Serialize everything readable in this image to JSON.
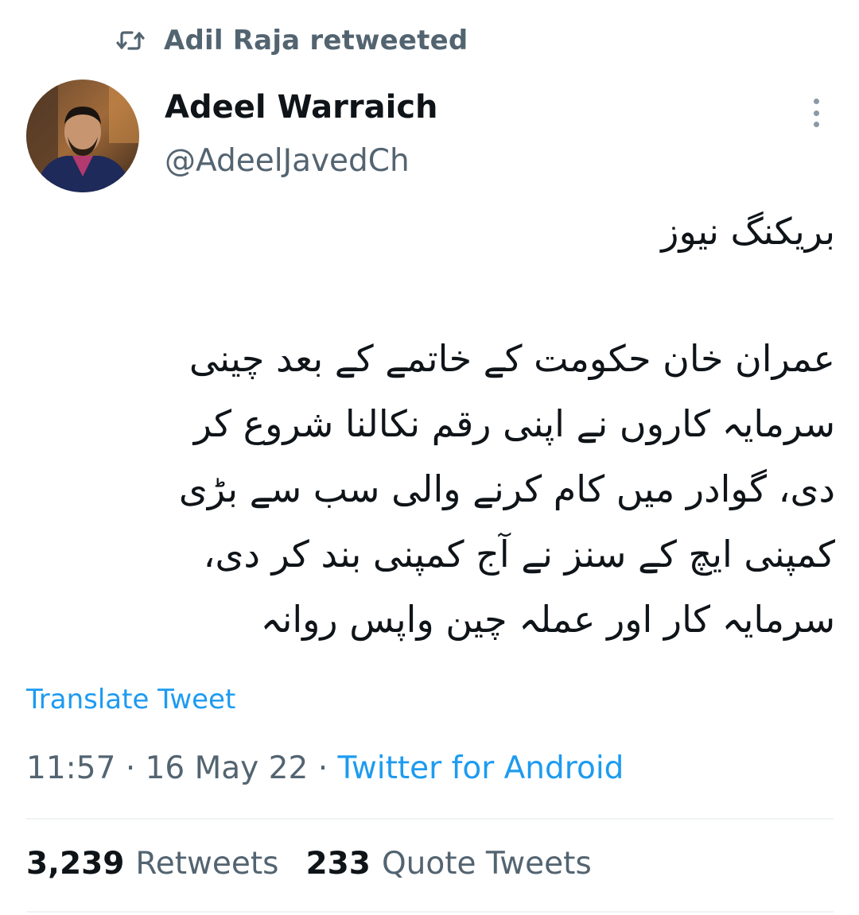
{
  "retweet_header": {
    "icon": "retweet-icon",
    "label": "Adil Raja retweeted"
  },
  "author": {
    "name": "Adeel Warraich",
    "handle": "@AdeelJavedCh",
    "avatar": "avatar-photo"
  },
  "more_icon": "more-vertical-icon",
  "tweet": {
    "heading": "بریکنگ نیوز",
    "lines": [
      "عمران خان حکومت کے خاتمے کے بعد چینی",
      "سرمایہ کاروں نے اپنی رقم نکالنا شروع کر",
      "دی، گوادر میں کام کرنے والی سب سے بڑی",
      "کمپنی ایچ کے سنز نے آج کمپنی بند کر دی،",
      "سرمایہ کار اور عملہ چین واپس روانہ"
    ]
  },
  "translate_label": "Translate Tweet",
  "meta": {
    "time": "11:57",
    "separator": "·",
    "date": "16 May 22",
    "source": "Twitter for Android"
  },
  "stats": {
    "retweets_count": "3,239",
    "retweets_label": "Retweets",
    "quotes_count": "233",
    "quotes_label": "Quote Tweets"
  },
  "colors": {
    "link": "#1d9bf0",
    "secondary_text": "#536471",
    "primary_text": "#0f1419",
    "divider": "#eff3f4"
  }
}
